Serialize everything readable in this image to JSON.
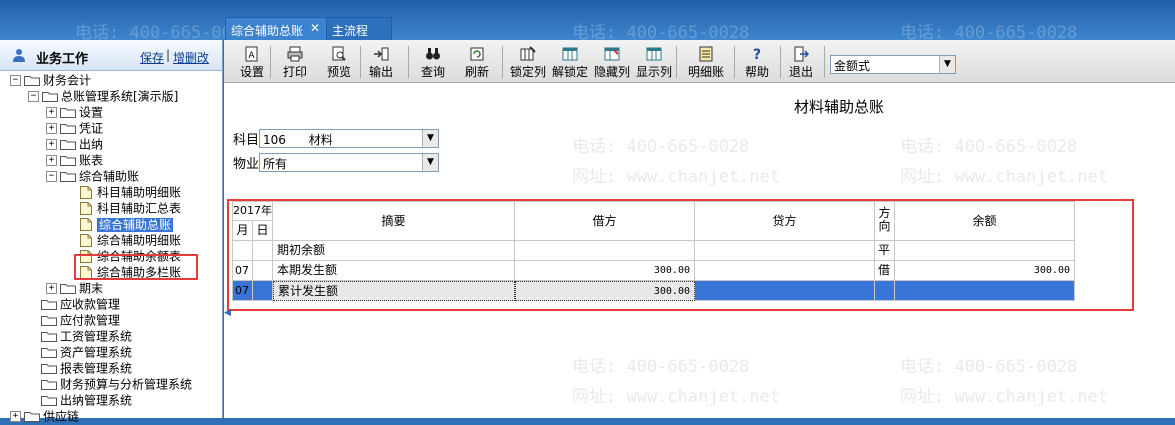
{
  "watermarks": {
    "phone": "电话: 400-665-0028",
    "web": "网址: www.chanjet.net"
  },
  "tabs": [
    {
      "label": "综合辅助总账",
      "close": "✕"
    },
    {
      "label": "主流程"
    }
  ],
  "left_panel": {
    "title": "业务工作",
    "save_label": "保存",
    "separator": "|",
    "add_delete_label": "增删改",
    "tree": [
      {
        "label": "财务会计",
        "toggle": "−",
        "level": 0,
        "type": "folder"
      },
      {
        "label": "总账管理系统[演示版]",
        "toggle": "−",
        "level": 1,
        "type": "folder"
      },
      {
        "label": "设置",
        "toggle": "+",
        "level": 2,
        "type": "folder"
      },
      {
        "label": "凭证",
        "toggle": "+",
        "level": 2,
        "type": "folder"
      },
      {
        "label": "出纳",
        "toggle": "+",
        "level": 2,
        "type": "folder"
      },
      {
        "label": "账表",
        "toggle": "+",
        "level": 2,
        "type": "folder"
      },
      {
        "label": "综合辅助账",
        "toggle": "−",
        "level": 2,
        "type": "folder"
      },
      {
        "label": "科目辅助明细账",
        "level": 3,
        "type": "doc"
      },
      {
        "label": "科目辅助汇总表",
        "level": 3,
        "type": "doc"
      },
      {
        "label": "综合辅助总账",
        "level": 3,
        "type": "doc",
        "selected": true
      },
      {
        "label": "综合辅助明细账",
        "level": 3,
        "type": "doc"
      },
      {
        "label": "综合辅助余额表",
        "level": 3,
        "type": "doc"
      },
      {
        "label": "综合辅助多栏账",
        "level": 3,
        "type": "doc"
      },
      {
        "label": "期末",
        "toggle": "+",
        "level": 2,
        "type": "folder"
      },
      {
        "label": "应收款管理",
        "level": 1,
        "type": "folder"
      },
      {
        "label": "应付款管理",
        "level": 1,
        "type": "folder"
      },
      {
        "label": "工资管理系统",
        "level": 1,
        "type": "folder"
      },
      {
        "label": "资产管理系统",
        "level": 1,
        "type": "folder"
      },
      {
        "label": "报表管理系统",
        "level": 1,
        "type": "folder"
      },
      {
        "label": "财务预算与分析管理系统",
        "level": 1,
        "type": "folder"
      },
      {
        "label": "出纳管理系统",
        "level": 1,
        "type": "folder"
      },
      {
        "label": "供应链",
        "toggle": "+",
        "level": 0,
        "type": "folder"
      }
    ]
  },
  "toolbar": {
    "buttons": [
      {
        "label": "设置",
        "icon": "settings-icon"
      },
      {
        "label": "打印",
        "icon": "printer-icon"
      },
      {
        "label": "预览",
        "icon": "preview-icon"
      },
      {
        "label": "输出",
        "icon": "export-icon"
      },
      {
        "label": "查询",
        "icon": "binoculars-icon"
      },
      {
        "label": "刷新",
        "icon": "refresh-icon"
      },
      {
        "label": "锁定列",
        "icon": "lock-column-icon"
      },
      {
        "label": "解锁定",
        "icon": "unlock-icon"
      },
      {
        "label": "隐藏列",
        "icon": "hide-column-icon"
      },
      {
        "label": "显示列",
        "icon": "show-column-icon"
      },
      {
        "label": "明细账",
        "icon": "detail-ledger-icon"
      },
      {
        "label": "帮助",
        "icon": "help-icon"
      },
      {
        "label": "退出",
        "icon": "exit-icon"
      }
    ],
    "format_select": "金额式"
  },
  "report": {
    "title": "材料辅助总账",
    "subject_label": "科目",
    "subject_value": "106      材料",
    "item_label": "物业",
    "item_value": "所有"
  },
  "table": {
    "year_header": "2017年",
    "month_header": "月",
    "day_header": "日",
    "summary_header": "摘要",
    "debit_header": "借方",
    "credit_header": "贷方",
    "direction_header": "方向",
    "balance_header": "余额",
    "rows": [
      {
        "month": "",
        "day": "",
        "summary": "期初余额",
        "debit": "",
        "credit": "",
        "direction": "平",
        "balance": ""
      },
      {
        "month": "07",
        "day": "",
        "summary": "本期发生额",
        "debit": "300.00",
        "credit": "",
        "direction": "借",
        "balance": "300.00"
      },
      {
        "month": "07",
        "day": "",
        "summary": "累计发生额",
        "debit": "300.00",
        "credit": "",
        "direction": "",
        "balance": "",
        "selected": true
      }
    ]
  }
}
